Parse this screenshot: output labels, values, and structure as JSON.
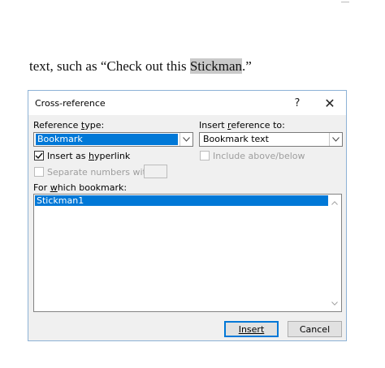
{
  "document": {
    "before": "text, such as “Check out this ",
    "highlight": "Stickman",
    "after": ".”"
  },
  "dialog": {
    "title": "Cross-reference",
    "help": "?",
    "close": "✕",
    "reference_type": {
      "label": "Reference type:",
      "value": "Bookmark"
    },
    "insert_reference_to": {
      "label": "Insert reference to:",
      "value": "Bookmark text"
    },
    "insert_as_hyperlink": {
      "label": "Insert as hyperlink",
      "checked": true
    },
    "include_above_below": {
      "label": "Include above/below",
      "checked": false
    },
    "separate_numbers_with": {
      "label": "Separate numbers with",
      "value": ""
    },
    "for_which": {
      "label": "For which bookmark:",
      "items": [
        "Stickman1"
      ]
    },
    "buttons": {
      "insert": "Insert",
      "cancel": "Cancel"
    }
  }
}
